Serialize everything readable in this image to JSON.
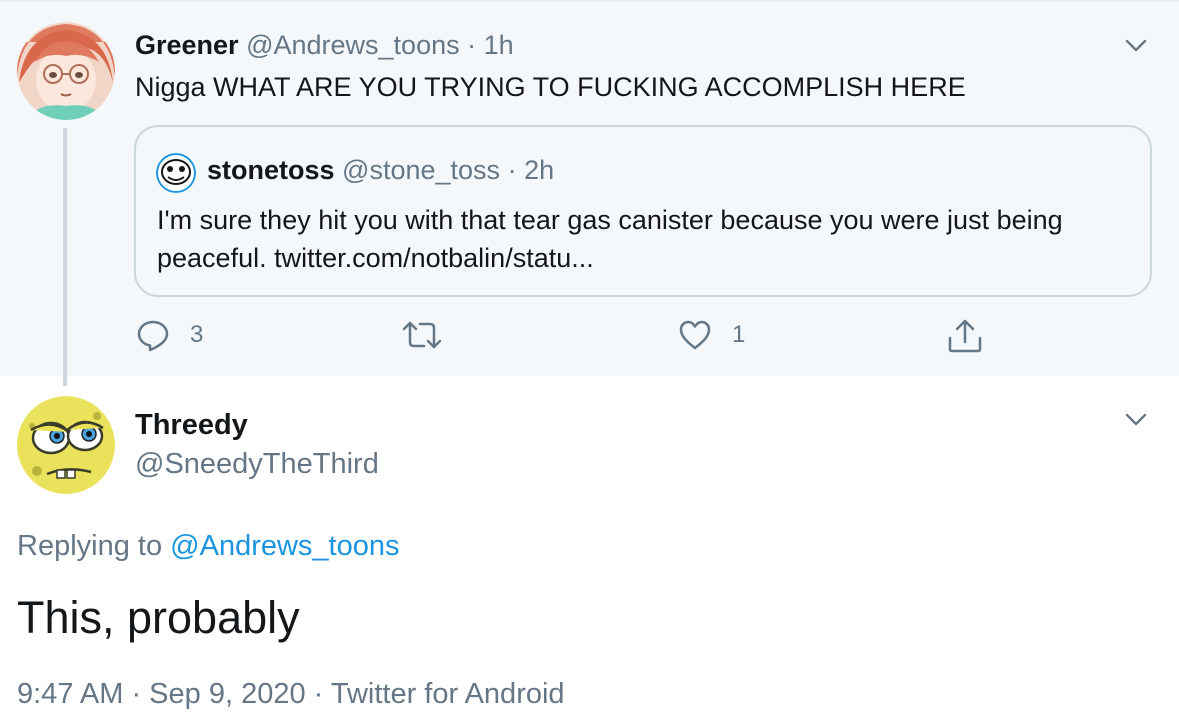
{
  "parent_tweet": {
    "author_name": "Greener",
    "author_handle": "@Andrews_toons",
    "separator": "·",
    "time": "1h",
    "text": "Nigga WHAT ARE YOU TRYING TO FUCKING ACCOMPLISH HERE",
    "quoted": {
      "author_name": "stonetoss",
      "author_handle": "@stone_toss",
      "separator": "·",
      "time": "2h",
      "text": "I'm sure they hit you with that tear gas canister because you were just being peaceful. twitter.com/notbalin/statu..."
    },
    "actions": {
      "reply_count": "3",
      "retweet_count": "",
      "like_count": "1"
    }
  },
  "reply_tweet": {
    "author_name": "Threedy",
    "author_handle": "@SneedyTheThird",
    "replying_label": "Replying to",
    "replying_to": "@Andrews_toons",
    "text": "This, probably",
    "meta": "9:47 AM · Sep 9, 2020 · Twitter for Android"
  },
  "icons": {
    "caret": "chevron-down-icon",
    "reply": "reply-icon",
    "retweet": "retweet-icon",
    "like": "heart-icon",
    "share": "share-icon"
  },
  "colors": {
    "parent_bg": "#f5f8fa",
    "link": "#1b95e0",
    "muted": "#657786",
    "text": "#14171a",
    "border": "#ccd6dd"
  }
}
